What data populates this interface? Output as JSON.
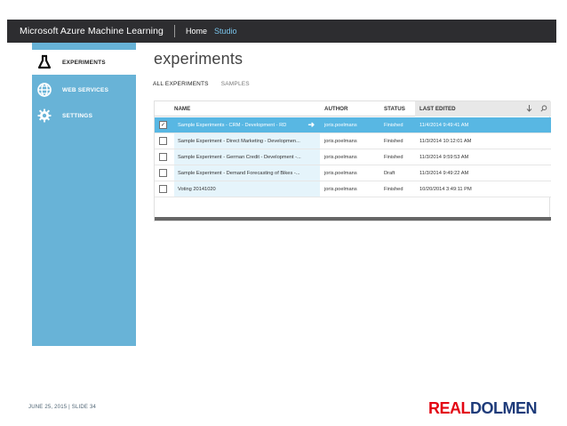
{
  "app": {
    "brand": "Microsoft Azure Machine Learning",
    "nav": {
      "home": "Home",
      "studio": "Studio"
    }
  },
  "sidebar": {
    "items": [
      {
        "label": "EXPERIMENTS",
        "icon": "flask-icon",
        "active": true
      },
      {
        "label": "WEB SERVICES",
        "icon": "globe-icon",
        "active": false
      },
      {
        "label": "SETTINGS",
        "icon": "gear-icon",
        "active": false
      }
    ]
  },
  "main": {
    "title": "experiments",
    "tabs": [
      {
        "label": "ALL EXPERIMENTS",
        "active": true
      },
      {
        "label": "SAMPLES",
        "active": false
      }
    ],
    "table": {
      "columns": [
        "NAME",
        "AUTHOR",
        "STATUS",
        "LAST EDITED"
      ],
      "rows": [
        {
          "checked": true,
          "name": "Sample Experiments - CRM - Development - RD",
          "author": "joris.poelmans",
          "status": "Finished",
          "edited": "11/4/2014 9:49:41 AM",
          "selected": true
        },
        {
          "checked": false,
          "name": "Sample Experiment - Direct Marketing - Developmen...",
          "author": "joris.poelmans",
          "status": "Finished",
          "edited": "11/3/2014 10:12:01 AM",
          "selected": false
        },
        {
          "checked": false,
          "name": "Sample Experiment - German Credit - Development -...",
          "author": "joris.poelmans",
          "status": "Finished",
          "edited": "11/3/2014 9:59:53 AM",
          "selected": false
        },
        {
          "checked": false,
          "name": "Sample Experiment - Demand Forecasting of Bikes -...",
          "author": "joris.poelmans",
          "status": "Draft",
          "edited": "11/3/2014 9:49:22 AM",
          "selected": false
        },
        {
          "checked": false,
          "name": "Voting 20141020",
          "author": "joris.poelmans",
          "status": "Finished",
          "edited": "10/20/2014 3:49:11 PM",
          "selected": false
        }
      ]
    }
  },
  "footer": {
    "date": "JUNE 25, 2015 | SLIDE 34",
    "logo_real": "REAL",
    "logo_dolmen": "DOLMEN"
  },
  "colors": {
    "topbar": "#2d2d30",
    "sidebar": "#68b3d7",
    "selected_row": "#58b7e3",
    "logo_red": "#e30613",
    "logo_blue": "#1e3b7a"
  }
}
